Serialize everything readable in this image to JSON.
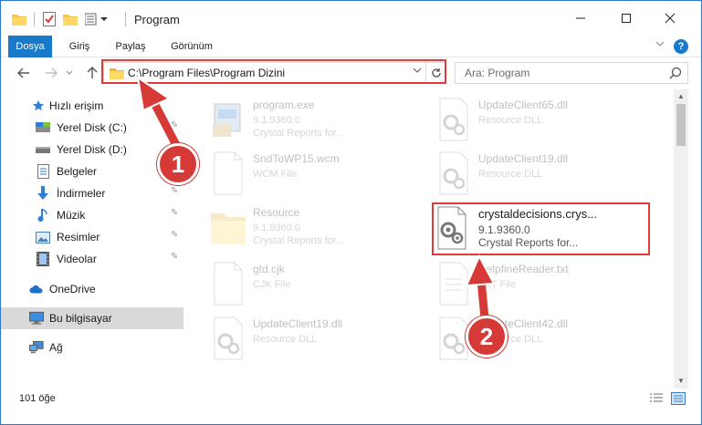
{
  "window": {
    "title": "Program"
  },
  "ribbon": {
    "tabs": [
      "Dosya",
      "Giriş",
      "Paylaş",
      "Görünüm"
    ],
    "help_label": "?"
  },
  "address": {
    "path": "C:\\Program Files\\Program Dizini",
    "search_placeholder": "Ara: Program"
  },
  "sidebar": {
    "items": [
      {
        "label": "Hızlı erişim",
        "icon": "star-icon"
      },
      {
        "label": "Yerel Disk (C:)",
        "icon": "drive-icon",
        "pinned": true
      },
      {
        "label": "Yerel Disk (D:)",
        "icon": "drive-icon",
        "pinned": true
      },
      {
        "label": "Belgeler",
        "icon": "documents-icon",
        "pinned": true
      },
      {
        "label": "İndirmeler",
        "icon": "downloads-icon",
        "pinned": true
      },
      {
        "label": "Müzik",
        "icon": "music-icon",
        "pinned": true
      },
      {
        "label": "Resimler",
        "icon": "pictures-icon",
        "pinned": true
      },
      {
        "label": "Videolar",
        "icon": "videos-icon",
        "pinned": true
      },
      {
        "label": "OneDrive",
        "icon": "onedrive-icon"
      },
      {
        "label": "Bu bilgisayar",
        "icon": "computer-icon",
        "selected": true
      },
      {
        "label": "Ağ",
        "icon": "network-icon"
      }
    ]
  },
  "files": [
    {
      "name": "program.exe",
      "line1": "9.1.9360.0",
      "line2": "Crystal Reports for...",
      "icon": "exe-icon",
      "faded": true
    },
    {
      "name": "UpdateClient65.dll",
      "line1": "Resource DLL",
      "line2": "",
      "icon": "dll-icon",
      "faded": true
    },
    {
      "name": "SndToWP15.wcm",
      "line1": "WCM File",
      "line2": "",
      "icon": "file-icon",
      "faded": true
    },
    {
      "name": "UpdateClient19.dll",
      "line1": "Resource DLL",
      "line2": "",
      "icon": "dll-icon",
      "faded": true
    },
    {
      "name": "Resource",
      "line1": "9.1.9360.0",
      "line2": "Crystal Reports for...",
      "icon": "folder-icon",
      "faded": true
    },
    {
      "name": "crystaldecisions.crys...",
      "line1": "9.1.9360.0",
      "line2": "Crystal Reports for...",
      "icon": "dll-icon",
      "faded": false
    },
    {
      "name": "gtd.cjk",
      "line1": "CJK File",
      "line2": "",
      "icon": "file-icon",
      "faded": true
    },
    {
      "name": "HelpfineReader.txt",
      "line1": "TXT File",
      "line2": "",
      "icon": "file-icon",
      "faded": true
    },
    {
      "name": "UpdateClient19.dll",
      "line1": "Resource DLL",
      "line2": "",
      "icon": "dll-icon",
      "faded": true
    },
    {
      "name": "UpdateClient42.dll",
      "line1": "Resource DLL",
      "line2": "",
      "icon": "dll-icon",
      "faded": true
    }
  ],
  "status": {
    "item_count": "101 öğe"
  },
  "annotations": {
    "step1": "1",
    "step2": "2",
    "color": "#e03a3a"
  }
}
